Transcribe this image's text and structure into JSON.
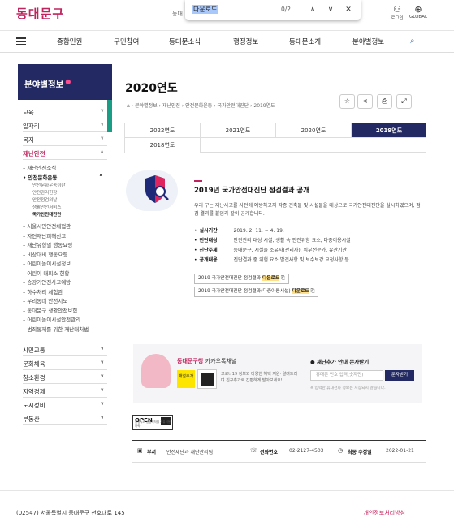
{
  "site": {
    "logo": "동대문구"
  },
  "header": {
    "top_link": "동대",
    "login_label": "로그인",
    "global_label": "GLOBAL"
  },
  "find_bar": {
    "query": "다운로드",
    "count": "0/2",
    "up": "∧",
    "down": "∨",
    "close": "✕"
  },
  "gnb": {
    "items": [
      "종합민원",
      "구민참여",
      "동대문소식",
      "행정정보",
      "동대문소개",
      "분야별정보"
    ]
  },
  "lnb": {
    "title": "분야별정보",
    "items": [
      "교육",
      "일자리",
      "복지",
      "재난안전"
    ],
    "sub": [
      "재난안전소식",
      "안전문화운동"
    ],
    "subsub": [
      "안전문화운동이란",
      "안전관리헌장",
      "안전점검의날",
      "생활안전서비스",
      "국가안전대진단"
    ],
    "sub2": [
      "서울시민안전체험관",
      "자연재난피해신고",
      "재난유형별 행동요령",
      "비상대비 행동요령",
      "어린이놀이시설정보",
      "어린이 대피소 현황",
      "승강기안전사고예방",
      "하수처리 체험관",
      "우리동네 안전지도",
      "동대문구 생활안전보험",
      "어린이놀이시설안전관리",
      "범죄통제를 위한 재난대처법"
    ],
    "bottom": [
      "시민교통",
      "문화체육",
      "청소환경",
      "지역경제",
      "도시정비",
      "부동산"
    ]
  },
  "page": {
    "title": "2020연도",
    "breadcrumb": [
      "⌂",
      "분야별정보",
      "재난안전",
      "안전문화운동",
      "국가안전대진단",
      "2019연도"
    ]
  },
  "tools": [
    "☆",
    "⋖",
    "⎙",
    "⤢"
  ],
  "tabs": {
    "row1": [
      "2022연도",
      "2021연도",
      "2020연도",
      "2019연도"
    ],
    "row2": [
      "2018연도"
    ],
    "active": "2019연도"
  },
  "card": {
    "title": "2019년 국가안전대진단 점검결과 공개",
    "desc": "우리 구는 재난사고를 사전에 예방하고자 각종 건축물 및 시설물을 대상으로 국가안전대진단을 실시하였으며, 점검 결과를 붙임과 같이 공개합니다.",
    "rows": [
      {
        "k": "실시기간",
        "v": "2019. 2. 11. ~ 4. 19."
      },
      {
        "k": "진단대상",
        "v": "안전관리 대상 시설, 생활 속 안전위험 요소, 다중이용시설"
      },
      {
        "k": "진단주체",
        "v": "동대문구, 시설물 소유자(관리자), 외부전문가, 유관기관"
      },
      {
        "k": "공개내용",
        "v": "진단결과 중 위험 요소 발견사항 및 보수보강 요청사항 등"
      }
    ],
    "downloads": [
      {
        "label": "2019 국가안전대진단 점검결과",
        "hl": "다운로드"
      },
      {
        "label": "2019 국가안전대진단 점검결과(다중이용시설)",
        "hl": "다운로드"
      }
    ]
  },
  "kakao": {
    "title": "동대문구청",
    "title2": "카카오톡채널",
    "tag": "채널추가",
    "desc": "코로나19 정보와 다양한 혜택 지원· 알려드리며 친구추가로 간편하게 받아보세요!",
    "sms_title": "재난추가 안내 문자받기",
    "sms_placeholder": "휴대폰 번호 입력(숫자만)",
    "sms_button": "문자받기",
    "sms_note": "※ 입력한 휴대전화 정보는 저장되지 않습니다."
  },
  "open": {
    "label": "OPEN",
    "sub": "공공누리 공공저작물 자유이용허락"
  },
  "info": {
    "dept_k": "부서",
    "dept_v": "안전재난과 재난관리팀",
    "tel_k": "전화번호",
    "tel_v": "02-2127-4503",
    "date_k": "최종 수정일",
    "date_v": "2022-01-21"
  },
  "footer": {
    "a": "(02547) 서울특별시 동대문구 천호대로 145",
    "b": "개인정보처리방침"
  }
}
